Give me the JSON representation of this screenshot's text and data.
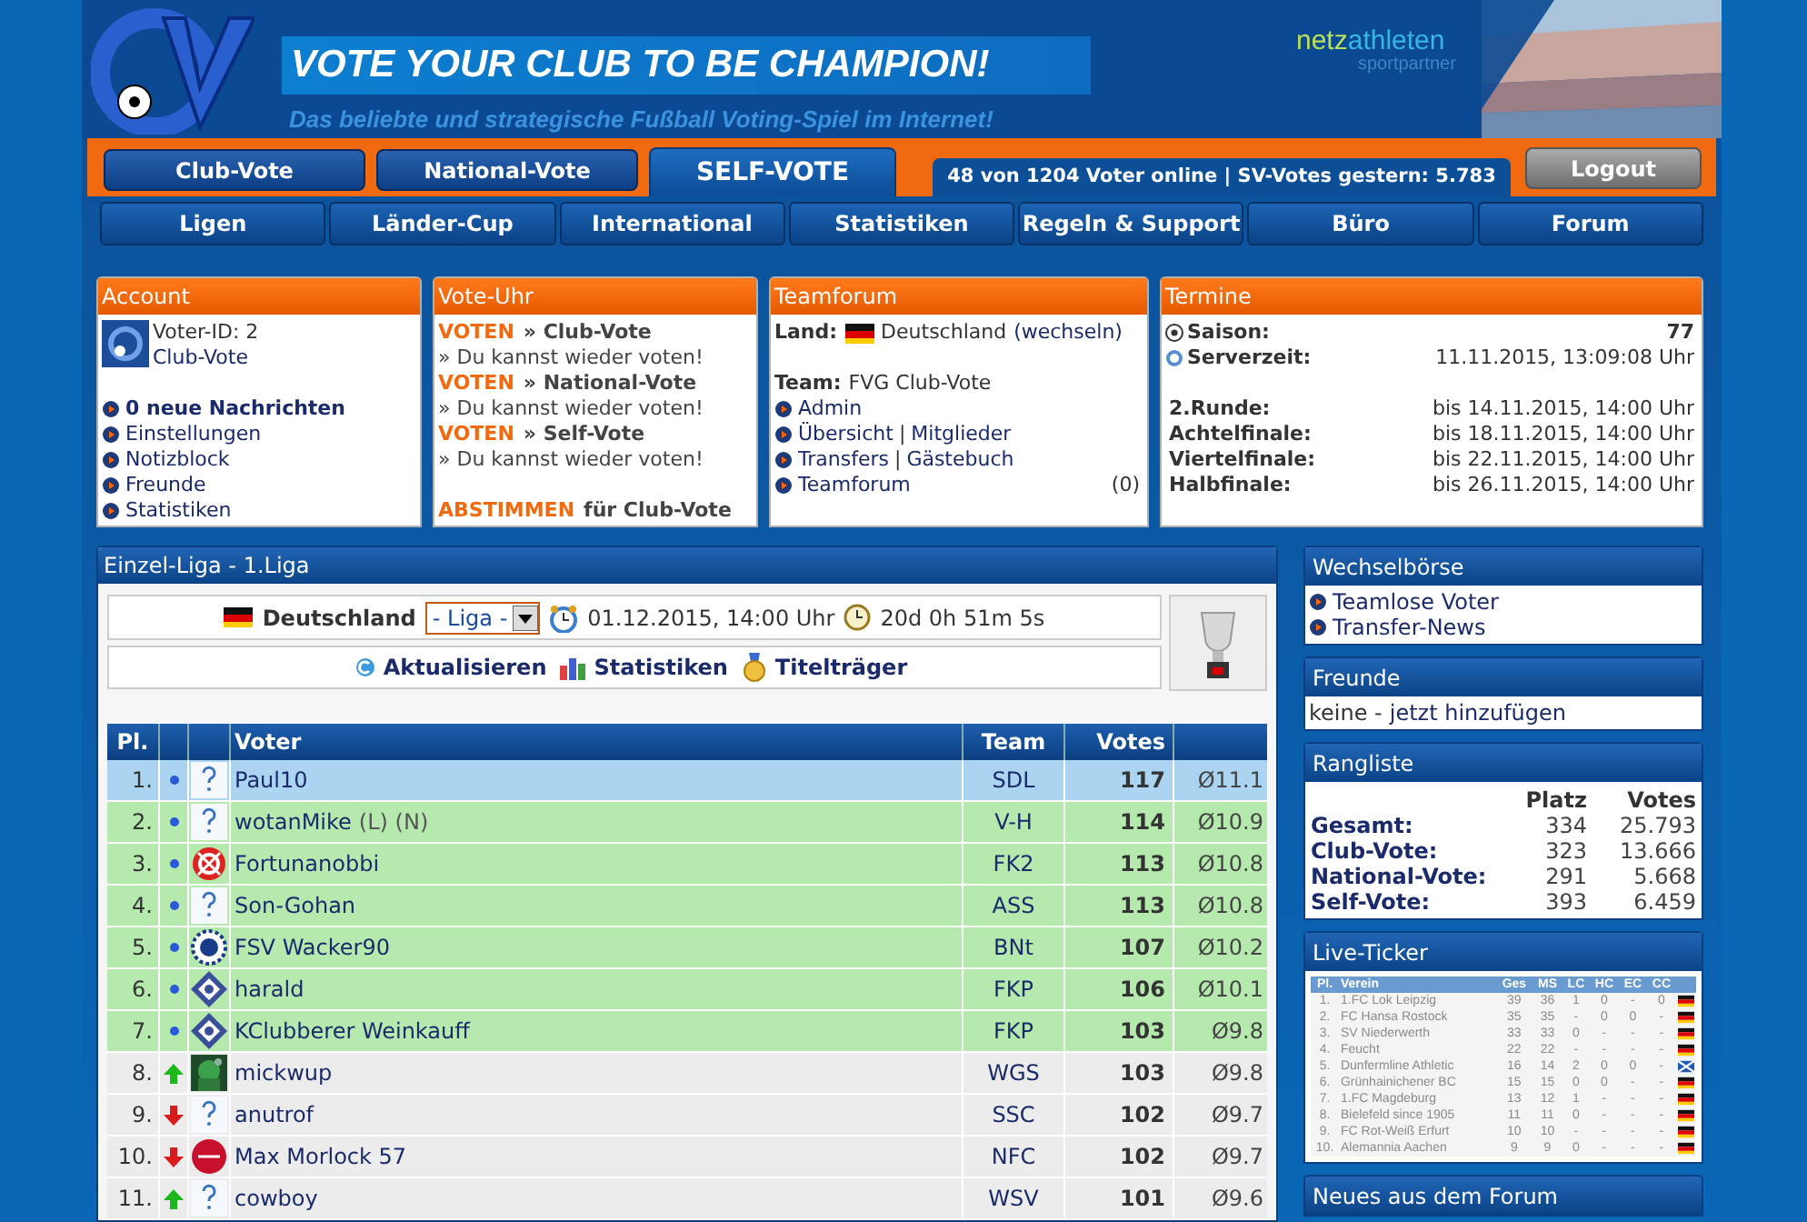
{
  "header": {
    "title": "VOTE YOUR CLUB TO BE CHAMPION!",
    "subtitle": "Das beliebte und strategische Fußball Voting-Spiel im Internet!",
    "sponsor": {
      "part_1": "netz",
      "part_2": "athleten",
      "tagline": "sportpartner"
    }
  },
  "main_nav": [
    {
      "label": "Club-Vote",
      "selected": false
    },
    {
      "label": "National-Vote",
      "selected": false
    },
    {
      "label": "SELF-VOTE",
      "selected": true
    }
  ],
  "online_status": "48 von 1204 Voter online | SV-Votes gestern: 5.783",
  "logout": "Logout",
  "sub_nav": [
    "Ligen",
    "Länder-Cup",
    "International",
    "Statistiken",
    "Regeln & Support",
    "Büro",
    "Forum"
  ],
  "account": {
    "title": "Account",
    "voter_id": "Voter-ID: 2",
    "game": "Club-Vote",
    "links": [
      {
        "label": "0 neue Nachrichten",
        "emphasized": true
      },
      {
        "label": "Einstellungen",
        "emphasized": false
      },
      {
        "label": "Notizblock",
        "emphasized": false
      },
      {
        "label": "Freunde",
        "emphasized": false
      },
      {
        "label": "Statistiken",
        "emphasized": false
      }
    ]
  },
  "vote_clock": {
    "title": "Vote-Uhr",
    "entries": [
      {
        "action": "VOTEN",
        "target": "» Club-Vote",
        "message": "» Du kannst wieder voten!"
      },
      {
        "action": "VOTEN",
        "target": "» National-Vote",
        "message": "» Du kannst wieder voten!"
      },
      {
        "action": "VOTEN",
        "target": "» Self-Vote",
        "message": "» Du kannst wieder voten!"
      }
    ],
    "footer_action": "ABSTIMMEN",
    "footer_text": "für Club-Vote"
  },
  "teamforum": {
    "title": "Teamforum",
    "land_label": "Land:",
    "land_value": "Deutschland",
    "land_link": "(wechseln)",
    "team_label": "Team:",
    "team_value": "FVG Club-Vote",
    "links": [
      {
        "parts": [
          {
            "text": "Admin",
            "kind": "link"
          }
        ]
      },
      {
        "parts": [
          {
            "text": "Übersicht",
            "kind": "link"
          },
          {
            "text": "|",
            "kind": "separator"
          },
          {
            "text": "Mitglieder",
            "kind": "link"
          }
        ]
      },
      {
        "parts": [
          {
            "text": "Transfers",
            "kind": "link"
          },
          {
            "text": "|",
            "kind": "separator"
          },
          {
            "text": "Gästebuch",
            "kind": "link"
          }
        ]
      },
      {
        "parts": [
          {
            "text": "Teamforum",
            "kind": "link"
          }
        ],
        "count": "(0)"
      }
    ]
  },
  "termine": {
    "title": "Termine",
    "season": {
      "label": "Saison:",
      "value": "77"
    },
    "server_time": {
      "label": "Serverzeit:",
      "value": "11.11.2015, 13:09:08 Uhr"
    },
    "rounds": [
      {
        "label": "2.Runde:",
        "value": "bis 14.11.2015, 14:00 Uhr"
      },
      {
        "label": "Achtelfinale:",
        "value": "bis 18.11.2015, 14:00 Uhr"
      },
      {
        "label": "Viertelfinale:",
        "value": "bis 22.11.2015, 14:00 Uhr"
      },
      {
        "label": "Halbfinale:",
        "value": "bis 26.11.2015, 14:00 Uhr"
      }
    ]
  },
  "league": {
    "title": "Einzel-Liga - 1.Liga",
    "country": "Deutschland",
    "select": "- Liga -",
    "date": "01.12.2015, 14:00 Uhr",
    "countdown": "20d 0h 51m 5s",
    "actions": [
      "Aktualisieren",
      "Statistiken",
      "Titelträger"
    ]
  },
  "table": {
    "columns": [
      "Pl.",
      "Voter",
      "Team",
      "Votes"
    ],
    "rows": [
      {
        "rank": "1.",
        "trend": {
          "kind": "same"
        },
        "avatar": {
          "kind": "unknown"
        },
        "name": "Paul10",
        "team": "SDL",
        "votes": "117",
        "average": "Ø11.1",
        "selected": true,
        "qualified": true
      },
      {
        "rank": "2.",
        "trend": {
          "kind": "same"
        },
        "avatar": {
          "kind": "unknown"
        },
        "name": "wotanMike",
        "suffix": "(L) (N)",
        "team": "V-H",
        "votes": "114",
        "average": "Ø10.9",
        "selected": false,
        "qualified": true
      },
      {
        "rank": "3.",
        "trend": {
          "kind": "same"
        },
        "avatar": {
          "kind": "red-crest"
        },
        "name": "Fortunanobbi",
        "team": "FK2",
        "votes": "113",
        "average": "Ø10.8",
        "selected": false,
        "qualified": true
      },
      {
        "rank": "4.",
        "trend": {
          "kind": "same"
        },
        "avatar": {
          "kind": "unknown"
        },
        "name": "Son-Gohan",
        "team": "ASS",
        "votes": "113",
        "average": "Ø10.8",
        "selected": false,
        "qualified": true
      },
      {
        "rank": "5.",
        "trend": {
          "kind": "same"
        },
        "avatar": {
          "kind": "blue-crest"
        },
        "name": "FSV Wacker90",
        "team": "BNt",
        "votes": "107",
        "average": "Ø10.2",
        "selected": false,
        "qualified": true
      },
      {
        "rank": "6.",
        "trend": {
          "kind": "same"
        },
        "avatar": {
          "kind": "diamond-crest"
        },
        "name": "harald",
        "team": "FKP",
        "votes": "106",
        "average": "Ø10.1",
        "selected": false,
        "qualified": true
      },
      {
        "rank": "7.",
        "trend": {
          "kind": "same"
        },
        "avatar": {
          "kind": "diamond-crest"
        },
        "name": "KClubberer Weinkauff",
        "team": "FKP",
        "votes": "103",
        "average": "Ø9.8",
        "selected": false,
        "qualified": true
      },
      {
        "rank": "8.",
        "trend": {
          "kind": "up"
        },
        "name": "mickwup",
        "team": "WGS",
        "votes": "103",
        "average": "Ø9.8",
        "selected": false,
        "qualified": false
      },
      {
        "rank": "9.",
        "trend": {
          "kind": "down"
        },
        "avatar": {
          "kind": "unknown"
        },
        "name": "anutrof",
        "team": "SSC",
        "votes": "102",
        "average": "Ø9.7",
        "selected": false,
        "qualified": false
      },
      {
        "rank": "10.",
        "trend": {
          "kind": "down"
        },
        "avatar": {
          "kind": "round-red-crest"
        },
        "name": "Max Morlock 57",
        "team": "NFC",
        "votes": "102",
        "average": "Ø9.7",
        "selected": false,
        "qualified": false
      },
      {
        "rank": "11.",
        "trend": {
          "kind": "up"
        },
        "avatar": {
          "kind": "unknown"
        },
        "name": "cowboy",
        "team": "WSV",
        "votes": "101",
        "average": "Ø9.6",
        "selected": false,
        "qualified": false
      }
    ]
  },
  "exchange": {
    "title": "Wechselbörse",
    "links": [
      "Teamlose Voter",
      "Transfer-News"
    ]
  },
  "friends": {
    "title": "Freunde",
    "prefix": "keine -",
    "link": "jetzt hinzufügen"
  },
  "ranking": {
    "title": "Rangliste",
    "columns": [
      "Platz",
      "Votes"
    ],
    "rows": [
      {
        "label": "Gesamt:",
        "place": "334",
        "votes": "25.793"
      },
      {
        "label": "Club-Vote:",
        "place": "323",
        "votes": "13.666"
      },
      {
        "label": "National-Vote:",
        "place": "291",
        "votes": "5.668"
      },
      {
        "label": "Self-Vote:",
        "place": "393",
        "votes": "6.459"
      }
    ]
  },
  "live_ticker": {
    "title": "Live-Ticker",
    "columns": [
      "Pl.",
      "Verein",
      "Ges",
      "MS",
      "LC",
      "HC",
      "EC",
      "CC"
    ],
    "rows": [
      {
        "cells": [
          "1.",
          "1.FC Lok Leipzig",
          "39",
          "36",
          "1",
          "0",
          "-",
          "0"
        ],
        "flag": {
          "kind": "de"
        }
      },
      {
        "cells": [
          "2.",
          "FC Hansa Rostock",
          "35",
          "35",
          "-",
          "0",
          "0",
          "-"
        ],
        "flag": {
          "kind": "de"
        }
      },
      {
        "cells": [
          "3.",
          "SV Niederwerth",
          "33",
          "33",
          "0",
          "-",
          "-",
          "-"
        ],
        "flag": {
          "kind": "de"
        }
      },
      {
        "cells": [
          "4.",
          "Feucht",
          "22",
          "22",
          "-",
          "-",
          "-",
          "-"
        ],
        "flag": {
          "kind": "de"
        }
      },
      {
        "cells": [
          "5.",
          "Dunfermline Athletic",
          "16",
          "14",
          "2",
          "0",
          "0",
          "-"
        ],
        "flag": {
          "kind": "sco"
        }
      },
      {
        "cells": [
          "6.",
          "Grünhainichener BC",
          "15",
          "15",
          "0",
          "0",
          "-",
          "-"
        ],
        "flag": {
          "kind": "de"
        }
      },
      {
        "cells": [
          "7.",
          "1.FC Magdeburg",
          "13",
          "12",
          "1",
          "-",
          "-",
          "-"
        ],
        "flag": {
          "kind": "de"
        }
      },
      {
        "cells": [
          "8.",
          "Bielefeld since 1905",
          "11",
          "11",
          "0",
          "-",
          "-",
          "-"
        ],
        "flag": {
          "kind": "de"
        }
      },
      {
        "cells": [
          "9.",
          "FC Rot-Weiß Erfurt",
          "10",
          "10",
          "-",
          "-",
          "-",
          "-"
        ],
        "flag": {
          "kind": "de"
        }
      },
      {
        "cells": [
          "10.",
          "Alemannia Aachen",
          "9",
          "9",
          "0",
          "-",
          "-",
          "-"
        ],
        "flag": {
          "kind": "de"
        }
      }
    ]
  },
  "forum_news": {
    "title": "Neues aus dem Forum"
  }
}
